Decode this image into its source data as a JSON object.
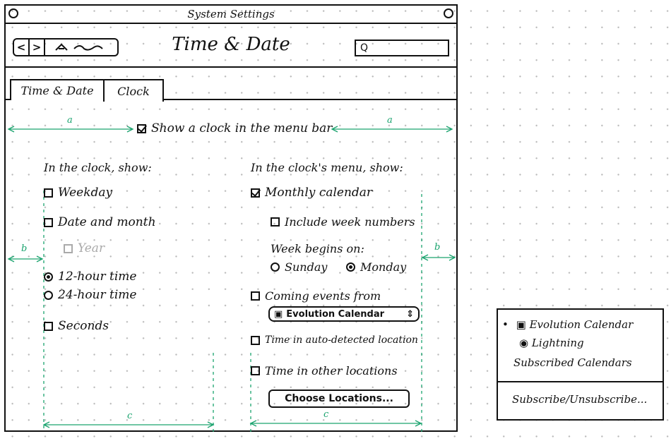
{
  "window": {
    "title": "System Settings"
  },
  "toolbar": {
    "back": "<",
    "forward": ">",
    "page_title": "Time & Date",
    "search_icon": "Q",
    "nav_extra_1": "",
    "nav_extra_2": ""
  },
  "tabs": [
    {
      "label": "Time & Date",
      "active": false
    },
    {
      "label": "Clock",
      "active": true
    }
  ],
  "menubar_option": {
    "label": "Show a clock in the menu bar",
    "checked": true
  },
  "measure_labels": {
    "a": "a",
    "b": "b",
    "c": "c"
  },
  "left": {
    "heading": "In the clock, show:",
    "weekday": {
      "label": "Weekday",
      "checked": false
    },
    "date_month": {
      "label": "Date and month",
      "checked": false
    },
    "year": {
      "label": "Year",
      "checked": false,
      "disabled": true
    },
    "hour12": {
      "label": "12-hour time",
      "selected": true
    },
    "hour24": {
      "label": "24-hour time",
      "selected": false
    },
    "seconds": {
      "label": "Seconds",
      "checked": false
    }
  },
  "right": {
    "heading": "In the clock's menu, show:",
    "monthly_calendar": {
      "label": "Monthly calendar",
      "checked": true
    },
    "week_numbers": {
      "label": "Include week numbers",
      "checked": false
    },
    "week_begins_label": "Week begins on:",
    "sunday": {
      "label": "Sunday",
      "selected": false
    },
    "monday": {
      "label": "Monday",
      "selected": true
    },
    "coming_events": {
      "label": "Coming events from",
      "checked": false
    },
    "calendar_popup": "Evolution Calendar",
    "auto_location": {
      "label": "Time in auto-detected location",
      "checked": false
    },
    "other_locations": {
      "label": "Time in other locations",
      "checked": false
    },
    "choose_locations": "Choose Locations..."
  },
  "calendar_menu": {
    "items": [
      {
        "label": "Evolution Calendar",
        "selected": true
      },
      {
        "label": "Lightning",
        "selected": false
      },
      {
        "label": "Subscribed Calendars",
        "selected": false
      }
    ],
    "subscribe": "Subscribe/Unsubscribe..."
  },
  "colors": {
    "guide": "#1aa36e",
    "ink": "#111111",
    "disabled": "#aaaaaa"
  }
}
